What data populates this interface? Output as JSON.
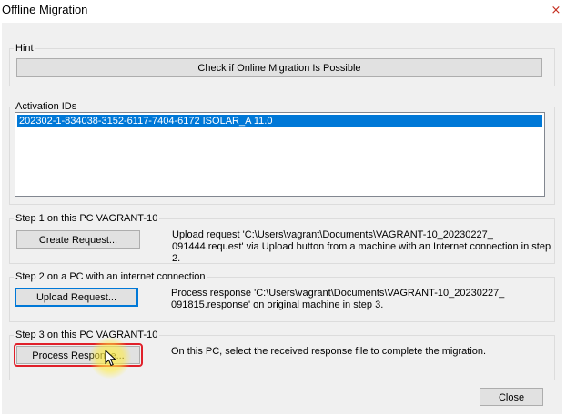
{
  "window": {
    "title": "Offline Migration",
    "close_glyph": "×"
  },
  "hint": {
    "label": "Hint",
    "check_button": "Check if Online Migration Is Possible"
  },
  "activation": {
    "label": "Activation IDs",
    "items": [
      "202302-1-834038-3152-6117-7404-6172 ISOLAR_A 11.0"
    ]
  },
  "step1": {
    "label": "Step 1 on this PC VAGRANT-10",
    "button": "Create Request...",
    "desc_line1": "Upload request 'C:\\Users\\vagrant\\Documents\\VAGRANT-10_20230227_",
    "desc_line2": "091444.request' via Upload button from a machine with an Internet connection in step 2."
  },
  "step2": {
    "label": "Step 2 on a PC with an internet connection",
    "button": "Upload Request...",
    "desc_line1": "Process response 'C:\\Users\\vagrant\\Documents\\VAGRANT-10_20230227_",
    "desc_line2": "091815.response' on original machine in step 3."
  },
  "step3": {
    "label": "Step 3 on this PC VAGRANT-10",
    "button": "Process Response...",
    "desc": "On this PC, select the received response file to complete the migration."
  },
  "footer": {
    "close_button": "Close"
  },
  "colors": {
    "selection": "#0078d7",
    "highlight_ring": "#e0202a",
    "window_bg": "#f0f0f0"
  }
}
